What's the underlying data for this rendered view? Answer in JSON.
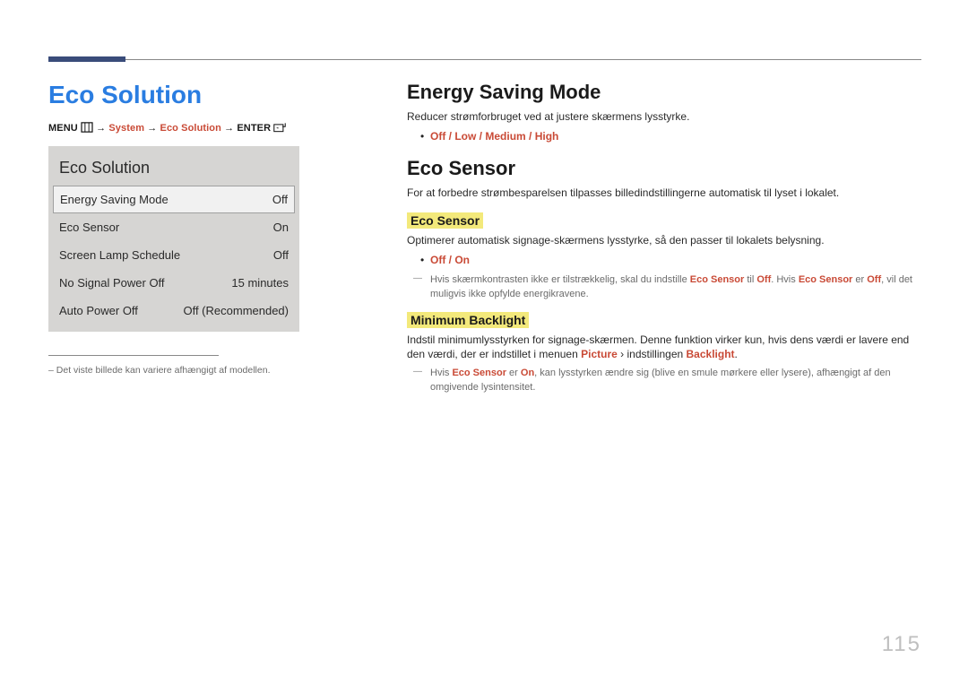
{
  "page_number": "115",
  "left": {
    "title": "Eco Solution",
    "breadcrumb": {
      "menu": "MENU",
      "arrow": "→",
      "system": "System",
      "eco": "Eco Solution",
      "enter": "ENTER"
    },
    "osd": {
      "title": "Eco Solution",
      "rows": [
        {
          "label": "Energy Saving Mode",
          "value": "Off",
          "selected": true
        },
        {
          "label": "Eco Sensor",
          "value": "On",
          "selected": false
        },
        {
          "label": "Screen Lamp Schedule",
          "value": "Off",
          "selected": false
        },
        {
          "label": "No Signal Power Off",
          "value": "15 minutes",
          "selected": false
        },
        {
          "label": "Auto Power Off",
          "value": "Off (Recommended)",
          "selected": false
        }
      ]
    },
    "footnote_dash": "–",
    "footnote": "Det viste billede kan variere afhængigt af modellen."
  },
  "right": {
    "energy": {
      "title": "Energy Saving Mode",
      "desc": "Reducer strømforbruget ved at justere skærmens lysstyrke.",
      "options": {
        "off": "Off",
        "low": "Low",
        "medium": "Medium",
        "high": "High",
        "sep": " / "
      }
    },
    "ecosensor": {
      "title": "Eco Sensor",
      "desc": "For at forbedre strømbesparelsen tilpasses billedindstillingerne automatisk til lyset i lokalet.",
      "sub1": {
        "title": "Eco Sensor",
        "desc": "Optimerer automatisk signage-skærmens lysstyrke, så den passer til lokalets belysning.",
        "options": {
          "off": "Off",
          "on": "On",
          "sep": " / "
        },
        "note_pre": "Hvis skærmkontrasten ikke er tilstrækkelig, skal du indstille ",
        "note_es1": "Eco Sensor",
        "note_mid1": " til ",
        "note_off": "Off",
        "note_mid2": ". Hvis ",
        "note_es2": "Eco Sensor",
        "note_mid3": " er ",
        "note_off2": "Off",
        "note_tail": ", vil det muligvis ikke opfylde energikravene."
      },
      "sub2": {
        "title": "Minimum Backlight",
        "desc_pre": "Indstil minimumlysstyrken for signage-skærmen. Denne funktion virker kun, hvis dens værdi er lavere end den værdi, der er indstillet i menuen ",
        "picture": "Picture",
        "arrow_small": "›",
        "desc_mid": " indstillingen ",
        "backlight": "Backlight",
        "desc_tail": ".",
        "note_pre": "Hvis ",
        "note_es": "Eco Sensor",
        "note_mid1": " er ",
        "note_on": "On",
        "note_tail": ", kan lysstyrken ændre sig (blive en smule mørkere eller lysere), afhængigt af den omgivende lysintensitet."
      }
    }
  }
}
